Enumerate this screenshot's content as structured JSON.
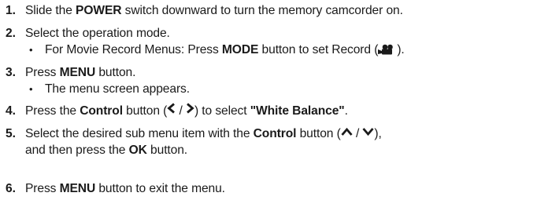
{
  "steps": [
    {
      "num": "1.",
      "pre": "Slide the ",
      "bold1": "POWER",
      "post": " switch downward to turn the memory camcorder on."
    },
    {
      "num": "2.",
      "text": "Select the operation mode.",
      "sub": {
        "bullet": "•",
        "pre": "For Movie Record Menus: Press ",
        "bold": "MODE",
        "mid": " button to set Record (",
        "icon": "movie-camera-icon",
        "post": ")."
      }
    },
    {
      "num": "3.",
      "pre": "Press ",
      "bold1": "MENU",
      "post": " button.",
      "sub": {
        "bullet": "•",
        "text": "The menu screen appears."
      }
    },
    {
      "num": "4.",
      "pre": "Press the ",
      "bold1": "Control",
      "mid": " button (",
      "icon_left": "chevron-left-icon",
      "slash": "/",
      "icon_right": "chevron-right-icon",
      "mid2": ") to select ",
      "bold2": "\"White Balance\"",
      "post": "."
    },
    {
      "num": "5.",
      "pre": "Select the desired sub menu item with the ",
      "bold1": "Control",
      "mid": " button (",
      "icon_up": "chevron-up-icon",
      "slash": "/",
      "icon_down": "chevron-down-icon",
      "mid2": "),",
      "line2_pre": "and then press the ",
      "line2_bold": "OK",
      "line2_post": " button."
    },
    {
      "num": "6.",
      "pre": "Press ",
      "bold1": "MENU",
      "post": " button to exit the menu."
    }
  ]
}
